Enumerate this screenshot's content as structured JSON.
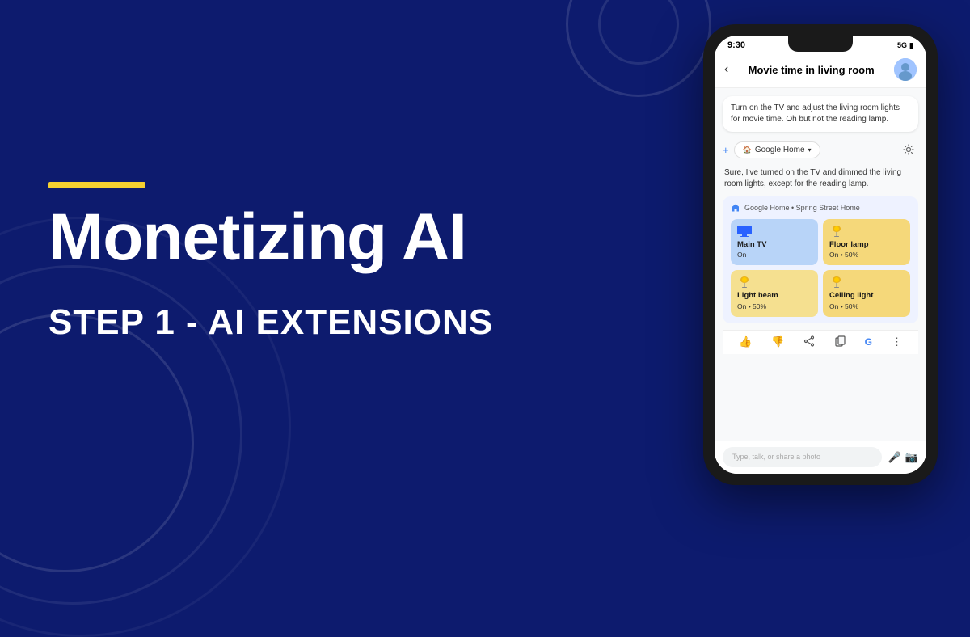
{
  "background": {
    "color": "#0d1b6e"
  },
  "left": {
    "accent_bar": "yellow-bar",
    "title": "Monetizing AI",
    "subtitle": "STEP 1 - AI EXTENSIONS"
  },
  "phone": {
    "status_bar": {
      "time": "9:30",
      "network": "5G",
      "signal": "▲"
    },
    "header": {
      "back_label": "‹",
      "title": "Movie time in living room"
    },
    "user_message": "Turn on the TV and adjust the living room lights for movie time. Oh but not the reading lamp.",
    "extension": {
      "label": "Google Home",
      "dropdown_icon": "⌄"
    },
    "ai_response": "Sure, I've turned on the TV and dimmed the living room lights, except for the reading lamp.",
    "google_home_header": "Google Home • Spring Street Home",
    "devices": [
      {
        "name": "Main TV",
        "status": "On",
        "type": "tv",
        "color": "blue"
      },
      {
        "name": "Floor lamp",
        "status": "On • 50%",
        "type": "bulb",
        "color": "yellow"
      },
      {
        "name": "Light beam",
        "status": "On • 50%",
        "type": "bulb",
        "color": "yellow-light"
      },
      {
        "name": "Ceiling light",
        "status": "On • 50%",
        "type": "bulb",
        "color": "yellow"
      }
    ],
    "action_icons": [
      "👍",
      "👎",
      "⬆",
      "📋",
      "G",
      "⋮"
    ],
    "input_placeholder": "Type, talk, or share a photo",
    "input_icons": [
      "🎤",
      "📷"
    ]
  }
}
